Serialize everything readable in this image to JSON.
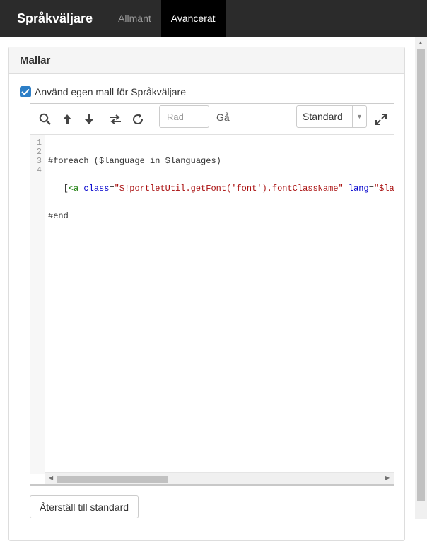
{
  "header": {
    "app_title": "Språkväljare",
    "tabs": [
      {
        "label": "Allmänt",
        "active": false
      },
      {
        "label": "Avancerat",
        "active": true
      }
    ]
  },
  "panel": {
    "title": "Mallar",
    "checkbox": {
      "label": "Använd egen mall för Språkväljare",
      "checked": true
    }
  },
  "editor": {
    "toolbar": {
      "icons": [
        "search-icon",
        "arrow-up-icon",
        "arrow-down-icon",
        "swap-icon",
        "refresh-icon",
        "expand-icon"
      ],
      "row_placeholder": "Rad",
      "go_label": "Gå",
      "theme_value": "Standard"
    },
    "line_numbers": [
      "1",
      "2",
      "3",
      "4"
    ],
    "code": {
      "line1": "#foreach ($language in $languages)",
      "line2_indent": "   [",
      "line2_tag": "<a",
      "line2_attr1": "class",
      "line2_eq1": "=",
      "line2_str1": "\"$!portletUtil.getFont('font').fontClassName\"",
      "line2_attr2": "lang",
      "line2_eq2": "=",
      "line2_str2": "\"$lan",
      "line3": "#end",
      "line4": ""
    }
  },
  "reset_button": "Återställ till standard",
  "colors": {
    "header_bg": "#2b2b2b",
    "active_tab_bg": "#000000",
    "checkbox_blue": "#2d7fc7"
  }
}
